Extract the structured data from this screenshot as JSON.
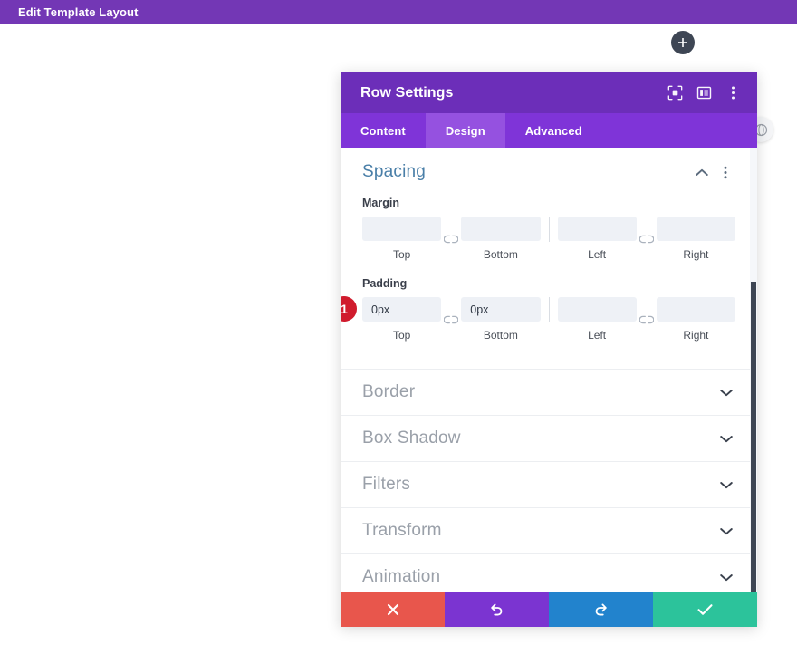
{
  "admin_bar": {
    "title": "Edit Template Layout"
  },
  "canvas": {
    "add_button_label": "+",
    "globe_icon": "globe-icon"
  },
  "modal": {
    "title": "Row Settings",
    "header_icons": [
      {
        "name": "focus-target-icon"
      },
      {
        "name": "layout-panel-icon"
      },
      {
        "name": "kebab-menu-icon"
      }
    ],
    "tabs": [
      {
        "label": "Content",
        "active": false
      },
      {
        "label": "Design",
        "active": true
      },
      {
        "label": "Advanced",
        "active": false
      }
    ],
    "spacing": {
      "title": "Spacing",
      "collapse_icon": "chevron-up-icon",
      "menu_icon": "kebab-menu-icon",
      "margin": {
        "label": "Margin",
        "fields": [
          {
            "caption": "Top",
            "value": "",
            "placeholder": ""
          },
          {
            "caption": "Bottom",
            "value": "",
            "placeholder": ""
          },
          {
            "caption": "Left",
            "value": "",
            "placeholder": ""
          },
          {
            "caption": "Right",
            "value": "",
            "placeholder": ""
          }
        ],
        "link_icon": "link-broken-icon"
      },
      "padding": {
        "label": "Padding",
        "badge": "1",
        "fields": [
          {
            "caption": "Top",
            "value": "0px",
            "placeholder": ""
          },
          {
            "caption": "Bottom",
            "value": "0px",
            "placeholder": ""
          },
          {
            "caption": "Left",
            "value": "",
            "placeholder": ""
          },
          {
            "caption": "Right",
            "value": "",
            "placeholder": ""
          }
        ],
        "link_icon": "link-broken-icon"
      }
    },
    "collapsed_sections": [
      {
        "label": "Border",
        "icon": "chevron-down-icon"
      },
      {
        "label": "Box Shadow",
        "icon": "chevron-down-icon"
      },
      {
        "label": "Filters",
        "icon": "chevron-down-icon"
      },
      {
        "label": "Transform",
        "icon": "chevron-down-icon"
      },
      {
        "label": "Animation",
        "icon": "chevron-down-icon"
      }
    ],
    "footer": [
      {
        "name": "cancel-button",
        "icon": "close-icon",
        "color": "#e8564c"
      },
      {
        "name": "undo-button",
        "icon": "undo-icon",
        "color": "#7b34d1"
      },
      {
        "name": "redo-button",
        "icon": "redo-icon",
        "color": "#2283cd"
      },
      {
        "name": "save-button",
        "icon": "check-icon",
        "color": "#2cc39b"
      }
    ]
  },
  "colors": {
    "admin_bar": "#7337b5",
    "modal_header": "#6c2eb9",
    "tab_bar": "#7f34d8",
    "tab_active": "#9551e0",
    "section_title": "#4a7fa8",
    "badge": "#d01b2d",
    "input_bg": "#eef1f6"
  }
}
